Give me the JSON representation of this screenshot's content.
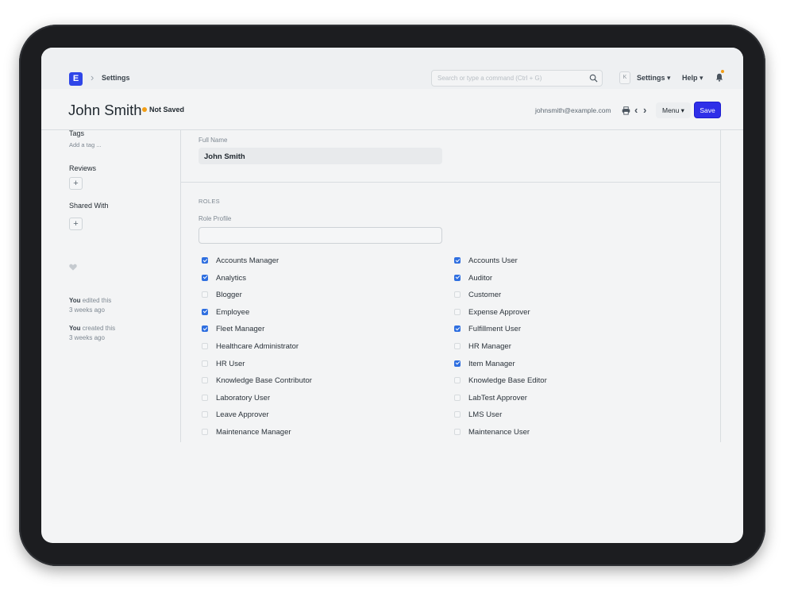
{
  "navbar": {
    "logo_letter": "E",
    "breadcrumb": "Settings",
    "search_placeholder": "Search or type a command (Ctrl + G)",
    "avatar_letter": "K",
    "settings_label": "Settings ▾",
    "help_label": "Help ▾"
  },
  "page": {
    "title": "John Smith",
    "status": "Not Saved",
    "email": "johnsmith@example.com",
    "menu_label": "Menu ▾",
    "save_label": "Save"
  },
  "sidebar": {
    "tags_label": "Tags",
    "add_tag": "Add a tag ...",
    "reviews_label": "Reviews",
    "shared_label": "Shared With",
    "plus": "+",
    "edited_who": "You",
    "edited_text": "edited this",
    "edited_when": "3 weeks ago",
    "created_who": "You",
    "created_text": "created this",
    "created_when": "3 weeks ago"
  },
  "form": {
    "full_name_label": "Full Name",
    "full_name_value": "John Smith",
    "roles_section": "ROLES",
    "role_profile_label": "Role Profile",
    "role_profile_value": "",
    "roles": [
      {
        "label": "Accounts Manager",
        "checked": true
      },
      {
        "label": "Accounts User",
        "checked": true
      },
      {
        "label": "Analytics",
        "checked": true
      },
      {
        "label": "Auditor",
        "checked": true
      },
      {
        "label": "Blogger",
        "checked": false
      },
      {
        "label": "Customer",
        "checked": false
      },
      {
        "label": "Employee",
        "checked": true
      },
      {
        "label": "Expense Approver",
        "checked": false
      },
      {
        "label": "Fleet Manager",
        "checked": true
      },
      {
        "label": "Fulfillment User",
        "checked": true
      },
      {
        "label": "Healthcare Administrator",
        "checked": false
      },
      {
        "label": "HR Manager",
        "checked": false
      },
      {
        "label": "HR User",
        "checked": false
      },
      {
        "label": "Item Manager",
        "checked": true
      },
      {
        "label": "Knowledge Base Contributor",
        "checked": false
      },
      {
        "label": "Knowledge Base Editor",
        "checked": false
      },
      {
        "label": "Laboratory User",
        "checked": false
      },
      {
        "label": "LabTest Approver",
        "checked": false
      },
      {
        "label": "Leave Approver",
        "checked": false
      },
      {
        "label": "LMS User",
        "checked": false
      },
      {
        "label": "Maintenance Manager",
        "checked": false
      },
      {
        "label": "Maintenance User",
        "checked": false
      }
    ]
  },
  "colors": {
    "primary": "#2f2fe8",
    "checkbox": "#2f6fe0",
    "status_dot": "#f29e16"
  },
  "icons": [
    "chevron-right-icon",
    "search-icon",
    "bell-icon",
    "print-icon",
    "chevron-left-icon",
    "heart-icon",
    "plus-icon"
  ]
}
